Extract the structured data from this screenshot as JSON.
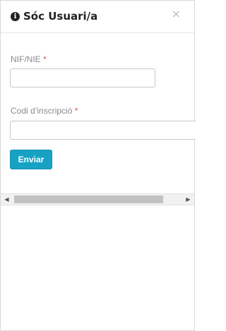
{
  "dialog": {
    "title": "Sóc Usuari/a",
    "info_icon_glyph": "i",
    "close_glyph": "×"
  },
  "form": {
    "nif_label": "NIF/NIE",
    "nif_required_mark": "*",
    "nif_value": "",
    "code_label": "Codi d’inscripció",
    "code_required_mark": "*",
    "code_value": "",
    "submit_label": "Enviar"
  },
  "scrollbar": {
    "left_arrow": "◀",
    "right_arrow": "▶"
  },
  "colors": {
    "accent": "#17a2c4",
    "required": "#d9534f"
  }
}
